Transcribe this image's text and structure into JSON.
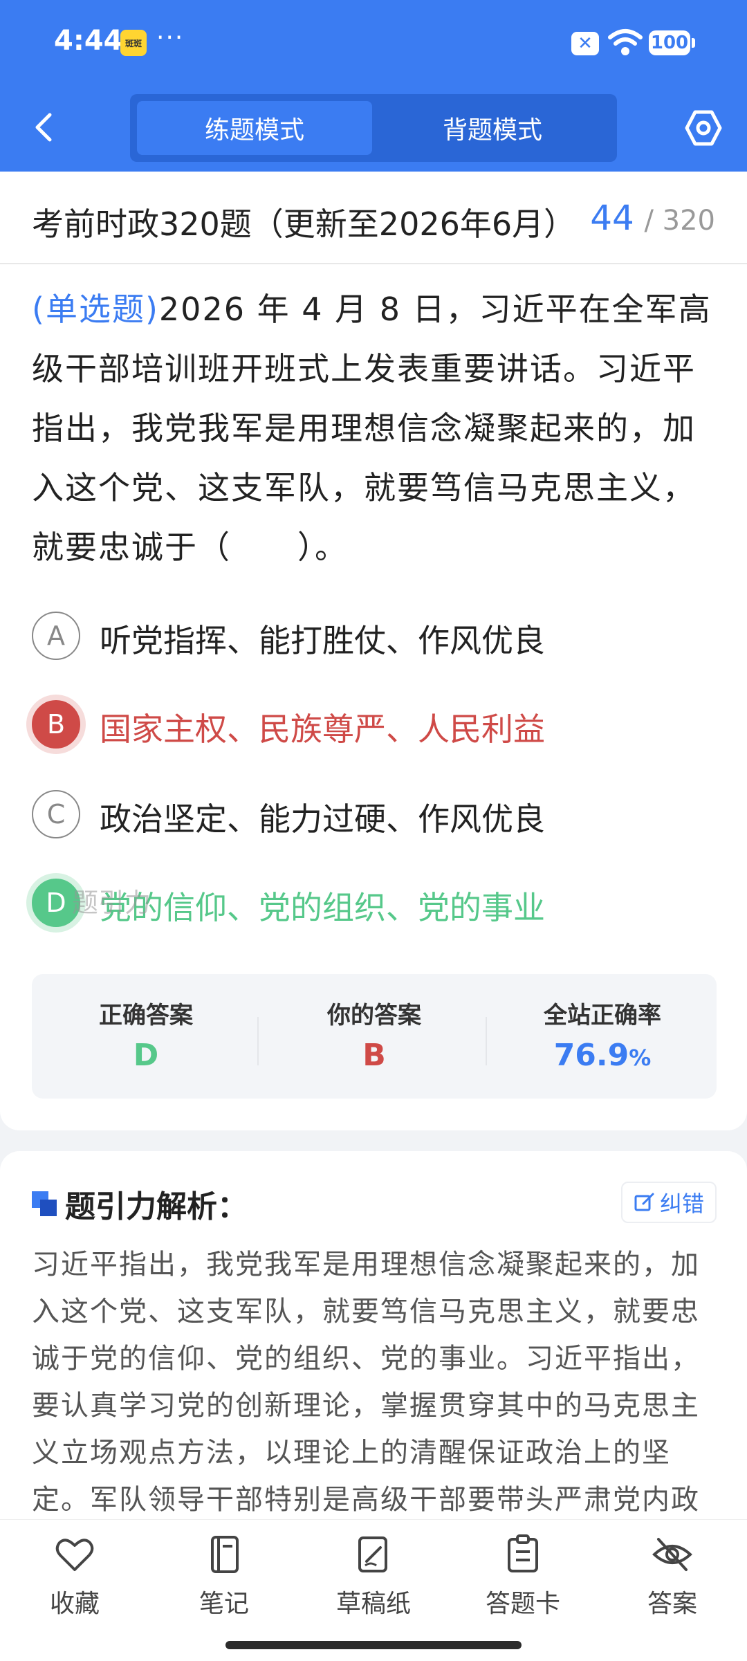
{
  "status_bar": {
    "time": "4:44",
    "app_badge": "斑斑",
    "more": "···",
    "battery": "100"
  },
  "header": {
    "tab_practice": "练题模式",
    "tab_review": "背题模式"
  },
  "exam": {
    "title": "考前时政320题（更新至2026年6月）",
    "current": "44",
    "total": "/ 320"
  },
  "question": {
    "type": "(单选题)",
    "stem": "2026 年 4 月 8 日，习近平在全军高级干部培训班开班式上发表重要讲话。习近平指出，我党我军是用理想信念凝聚起来的，加入这个党、这支军队，就要笃信马克思主义，就要忠诚于（　　）。",
    "options": [
      {
        "key": "A",
        "text": "听党指挥、能打胜仗、作风优良",
        "state": "normal"
      },
      {
        "key": "B",
        "text": "国家主权、民族尊严、人民利益",
        "state": "wrong"
      },
      {
        "key": "C",
        "text": "政治坚定、能力过硬、作风优良",
        "state": "normal"
      },
      {
        "key": "D",
        "text": "党的信仰、党的组织、党的事业",
        "state": "correct"
      }
    ],
    "watermark": "题引力"
  },
  "result": {
    "correct_label": "正确答案",
    "correct_value": "D",
    "your_label": "你的答案",
    "your_value": "B",
    "rate_label": "全站正确率",
    "rate_value": "76.9",
    "rate_unit": "%"
  },
  "analysis": {
    "title": "题引力解析：",
    "report_label": "纠错",
    "text": "习近平指出，我党我军是用理想信念凝聚起来的，加入这个党、这支军队，就要笃信马克思主义，就要忠诚于党的信仰、党的组织、党的事业。习近平指出，要认真学习党的创新理论，掌握贯穿其中的马克思主义立场观点方法，以理论上的清醒保证政治上的坚定。军队领导干部特别是高级干部要带头严肃党内政"
  },
  "toolbar": {
    "favorite": "收藏",
    "notes": "笔记",
    "scratch": "草稿纸",
    "answer_card": "答题卡",
    "answer": "答案"
  },
  "colors": {
    "primary": "#3b7cf2",
    "wrong": "#cf4a47",
    "correct": "#56c88a"
  }
}
